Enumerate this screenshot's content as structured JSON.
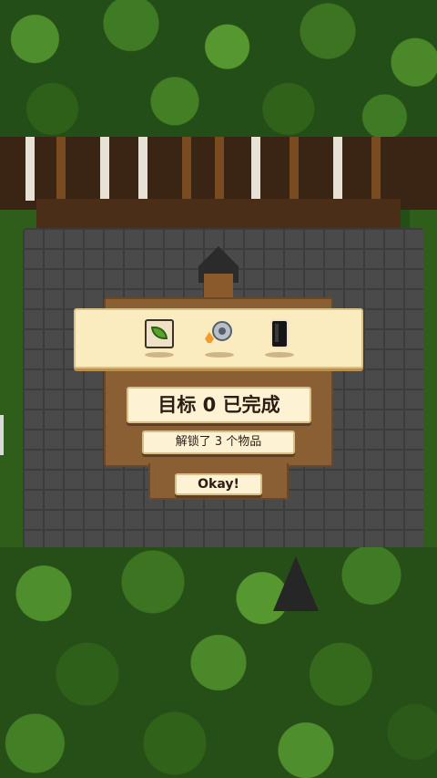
{
  "dialog": {
    "items": [
      {
        "icon": "leaf-card-icon"
      },
      {
        "icon": "gear-spark-icon"
      },
      {
        "icon": "dark-block-icon"
      }
    ],
    "goal_text": "目标 0 已完成",
    "unlock_text": "解锁了 3 个物品",
    "button_label": "Okay!"
  },
  "colors": {
    "panel_bg": "#fdf3d4",
    "dialog_wood": "#8a5f33",
    "text": "#2a1d12"
  }
}
